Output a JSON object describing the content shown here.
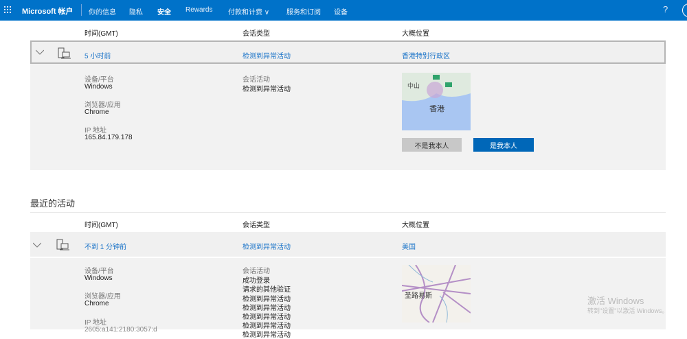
{
  "nav": {
    "brand": "Microsoft 帐户",
    "items": [
      "你的信息",
      "隐私",
      "安全",
      "Rewards",
      "付款和计费 ∨",
      "服务和订阅",
      "设备"
    ],
    "help": "?"
  },
  "columns": {
    "time": "时间(GMT)",
    "session_type": "会话类型",
    "location": "大概位置"
  },
  "sessions": [
    {
      "time": "5 小时前",
      "type": "检测到异常活动",
      "location": "香港特别行政区",
      "device_label": "设备/平台",
      "device": "Windows",
      "browser_label": "浏览器/应用",
      "browser": "Chrome",
      "ip_label": "IP 地址",
      "ip": "165.84.179.178",
      "activity_label": "会话活动",
      "activities": [
        "检测到异常活动"
      ],
      "map_labels": [
        "中山",
        "香港"
      ],
      "not_me": "不是我本人",
      "is_me": "是我本人"
    }
  ],
  "recent": {
    "title": "最近的活动",
    "sessions": [
      {
        "time": "不到 1 分钟前",
        "type": "检测到异常活动",
        "location": "美国",
        "device_label": "设备/平台",
        "device": "Windows",
        "browser_label": "浏览器/应用",
        "browser": "Chrome",
        "ip_label": "IP 地址",
        "ip": "2605:a141:2180:3057:d",
        "activity_label": "会话活动",
        "activities": [
          "成功登录",
          "请求的其他验证",
          "检测到异常活动",
          "检测到异常活动",
          "检测到异常活动",
          "检测到异常活动",
          "检测到异常活动"
        ],
        "map_labels": [
          "圣路易斯"
        ]
      }
    ]
  },
  "watermark": {
    "title": "激活 Windows",
    "subtitle": "转到\"设置\"以激活 Windows。"
  },
  "colors": {
    "nav": "#0072c9",
    "link": "#1a73c8",
    "primary_button": "#0067b8"
  }
}
